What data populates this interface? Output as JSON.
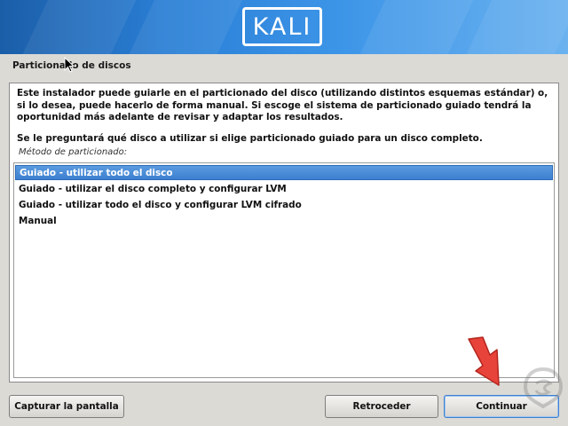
{
  "banner": {
    "logo_text": "KALI"
  },
  "section_title": "Particionado de discos",
  "description": "Este instalador puede guiarle en el particionado del disco (utilizando distintos esquemas estándar) o, si lo desea, puede hacerlo de forma manual. Si escoge el sistema de particionado guiado tendrá la oportunidad más adelante de revisar y adaptar los resultados.",
  "question": "Se le preguntará qué disco a utilizar si elige particionado guiado para un disco completo.",
  "method_label": "Método de particionado:",
  "options": [
    {
      "label": "Guiado - utilizar todo el disco",
      "selected": true
    },
    {
      "label": "Guiado - utilizar el disco completo y configurar LVM",
      "selected": false
    },
    {
      "label": "Guiado - utilizar todo el disco y configurar LVM cifrado",
      "selected": false
    },
    {
      "label": "Manual",
      "selected": false
    }
  ],
  "buttons": {
    "screenshot": "Capturar la pantalla",
    "back": "Retroceder",
    "continue": "Continuar"
  },
  "colors": {
    "selection": "#3d7fcf",
    "banner": "#2a7fd6",
    "arrow": "#e8433a"
  }
}
